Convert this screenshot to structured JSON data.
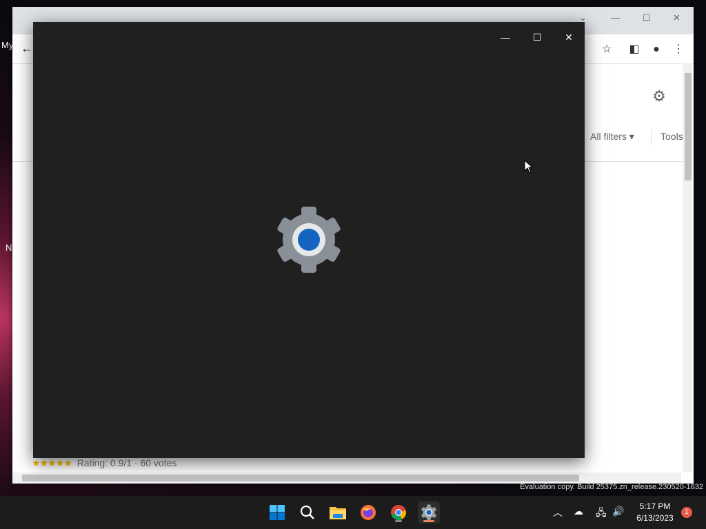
{
  "desktop": {
    "left_label_1": "My",
    "left_label_2": "N"
  },
  "chrome": {
    "filters_label": "All filters",
    "tools_label": "Tools",
    "rating_stars": "★★★★★",
    "rating_text": "Rating: 0.9/1 · 60 votes"
  },
  "settings_window": {
    "minimize_icon": "minimize-icon",
    "maximize_icon": "maximize-icon",
    "close_icon": "close-icon",
    "colors": {
      "background": "#202020",
      "gear_grey": "#8a9097",
      "gear_blue": "#1565c0"
    }
  },
  "watermark": "Evaluation copy. Build 25375.zn_release.230520-1632",
  "taskbar": {
    "apps": [
      {
        "name": "start-icon",
        "active": false
      },
      {
        "name": "search-icon",
        "active": false
      },
      {
        "name": "file-explorer-icon",
        "active": false
      },
      {
        "name": "firefox-icon",
        "active": false
      },
      {
        "name": "chrome-icon",
        "active": false
      },
      {
        "name": "settings-icon",
        "active": true
      }
    ],
    "time": "5:17 PM",
    "date": "6/13/2023",
    "notification_count": "1"
  }
}
